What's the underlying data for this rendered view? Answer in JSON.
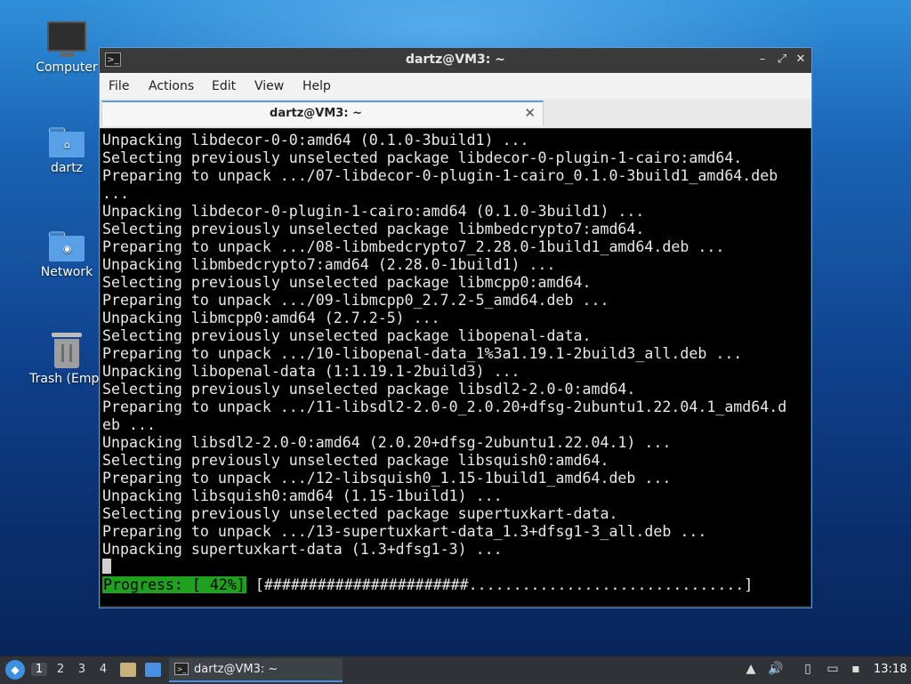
{
  "desktop": {
    "icons": [
      {
        "label": "Computer",
        "icon": "computer-icon"
      },
      {
        "label": "dartz",
        "icon": "home-folder-icon"
      },
      {
        "label": "Network",
        "icon": "network-folder-icon"
      },
      {
        "label": "Trash (Empt",
        "icon": "trash-icon"
      }
    ]
  },
  "window": {
    "title": "dartz@VM3: ~",
    "menu": [
      "File",
      "Actions",
      "Edit",
      "View",
      "Help"
    ],
    "tab_label": "dartz@VM3: ~",
    "terminal_lines": [
      "Unpacking libdecor-0-0:amd64 (0.1.0-3build1) ...",
      "Selecting previously unselected package libdecor-0-plugin-1-cairo:amd64.",
      "Preparing to unpack .../07-libdecor-0-plugin-1-cairo_0.1.0-3build1_amd64.deb",
      "...",
      "Unpacking libdecor-0-plugin-1-cairo:amd64 (0.1.0-3build1) ...",
      "Selecting previously unselected package libmbedcrypto7:amd64.",
      "Preparing to unpack .../08-libmbedcrypto7_2.28.0-1build1_amd64.deb ...",
      "Unpacking libmbedcrypto7:amd64 (2.28.0-1build1) ...",
      "Selecting previously unselected package libmcpp0:amd64.",
      "Preparing to unpack .../09-libmcpp0_2.7.2-5_amd64.deb ...",
      "Unpacking libmcpp0:amd64 (2.7.2-5) ...",
      "Selecting previously unselected package libopenal-data.",
      "Preparing to unpack .../10-libopenal-data_1%3a1.19.1-2build3_all.deb ...",
      "Unpacking libopenal-data (1:1.19.1-2build3) ...",
      "Selecting previously unselected package libsdl2-2.0-0:amd64.",
      "Preparing to unpack .../11-libsdl2-2.0-0_2.0.20+dfsg-2ubuntu1.22.04.1_amd64.d",
      "eb ...",
      "Unpacking libsdl2-2.0-0:amd64 (2.0.20+dfsg-2ubuntu1.22.04.1) ...",
      "Selecting previously unselected package libsquish0:amd64.",
      "Preparing to unpack .../12-libsquish0_1.15-1build1_amd64.deb ...",
      "Unpacking libsquish0:amd64 (1.15-1build1) ...",
      "Selecting previously unselected package supertuxkart-data.",
      "Preparing to unpack .../13-supertuxkart-data_1.3+dfsg1-3_all.deb ...",
      "Unpacking supertuxkart-data (1.3+dfsg1-3) ..."
    ],
    "progress_label": "Progress: [ 42%]",
    "progress_bar": "[#######################...............................]",
    "progress_percent": 42,
    "accent_color": "#5a9ad5",
    "progress_color": "#1fa11f"
  },
  "taskbar": {
    "workspaces": [
      "1",
      "2",
      "3",
      "4"
    ],
    "active_workspace": "1",
    "task_label": "dartz@VM3: ~",
    "clock": "13:18"
  }
}
